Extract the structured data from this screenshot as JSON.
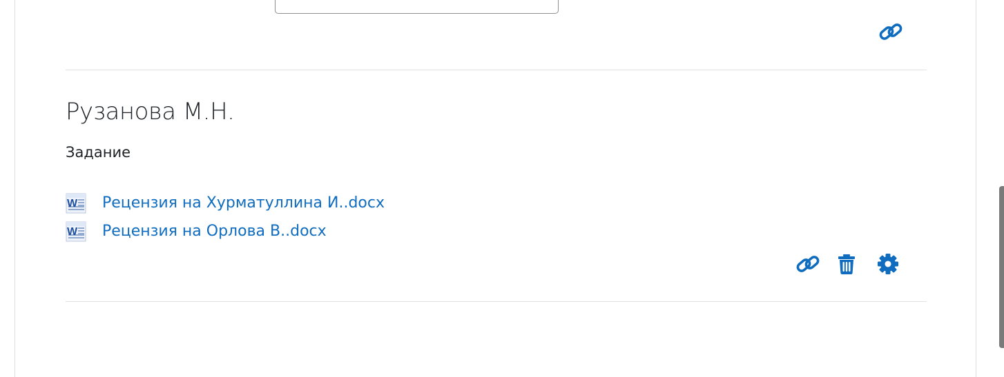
{
  "colors": {
    "accent": "#0f6cbf",
    "text": "#1d2125",
    "divider": "#e2e2e2"
  },
  "submission": {
    "author": "Рузанова М.Н.",
    "task_label": "Задание",
    "files": [
      {
        "name": "Рецензия на Хурматуллина И..docx",
        "icon": "word-doc-icon"
      },
      {
        "name": "Рецензия на Орлова В..docx",
        "icon": "word-doc-icon"
      }
    ]
  },
  "actions": {
    "previous": [
      "link-icon"
    ],
    "current": [
      "link-icon",
      "trash-icon",
      "gear-icon"
    ]
  }
}
